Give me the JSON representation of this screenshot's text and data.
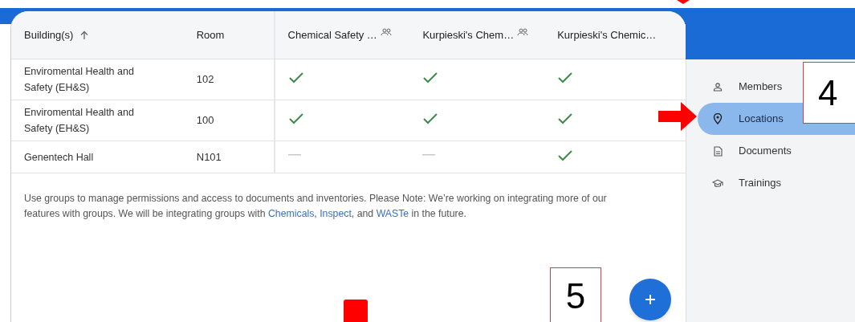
{
  "table": {
    "columns": [
      {
        "label": "Building(s)",
        "sorted": true,
        "group": false
      },
      {
        "label": "Room",
        "sorted": false,
        "group": false
      },
      {
        "label": "Chemical Safety …",
        "sorted": false,
        "group": true
      },
      {
        "label": "Kurpieski's Chem…",
        "sorted": false,
        "group": true
      },
      {
        "label": "Kurpieski's Chemic…",
        "sorted": false,
        "group": false
      }
    ],
    "rows": [
      {
        "building": "Enviromental Health and Safety (EH&S)",
        "room": "102",
        "access": [
          {
            "kind": "check"
          },
          {
            "kind": "check"
          },
          {
            "kind": "check"
          }
        ]
      },
      {
        "building": "Enviromental Health and Safety (EH&S)",
        "room": "100",
        "access": [
          {
            "kind": "check"
          },
          {
            "kind": "check"
          },
          {
            "kind": "check"
          }
        ]
      },
      {
        "building": "Genentech Hall",
        "room": "N101",
        "access": [
          {
            "kind": "none"
          },
          {
            "kind": "none"
          },
          {
            "kind": "check"
          }
        ]
      }
    ]
  },
  "note": {
    "text": "Use groups to manage permissions and access to documents and inventories. Please Note: We’re working on integrating more of our features with groups. We will be integrating groups with",
    "links": [
      "Chemicals",
      ", ",
      "Inspect",
      ", and ",
      "WASTe"
    ],
    "tail": "in the future."
  },
  "sidebar": {
    "items": [
      {
        "label": "Members",
        "selected": false
      },
      {
        "label": "Locations",
        "selected": true
      },
      {
        "label": "Documents",
        "selected": false
      },
      {
        "label": "Trainings",
        "selected": false
      }
    ]
  },
  "annotations": [
    "4",
    "5"
  ]
}
